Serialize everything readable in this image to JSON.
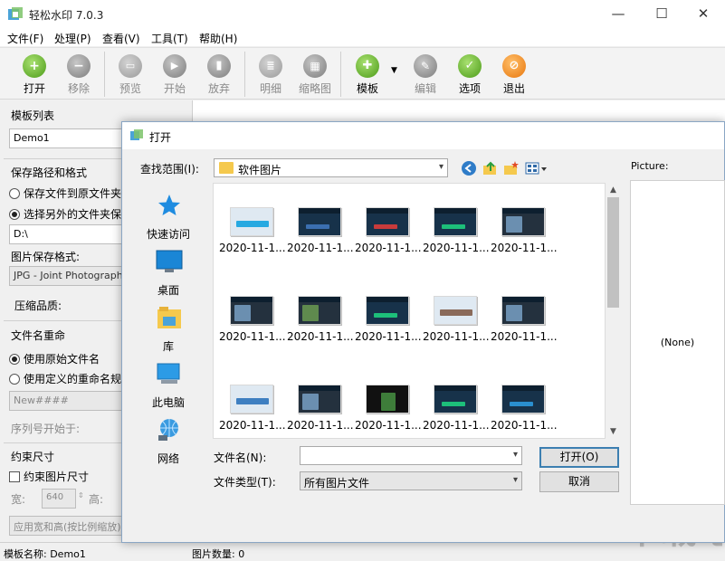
{
  "app": {
    "title": "轻松水印 7.0.3",
    "window_controls": {
      "minimize": "—",
      "maximize": "☐",
      "close": "✕"
    }
  },
  "menu": [
    "文件(F)",
    "处理(P)",
    "查看(V)",
    "工具(T)",
    "帮助(H)"
  ],
  "toolbar": [
    {
      "label": "打开",
      "icon": "plus-icon",
      "enabled": true
    },
    {
      "label": "移除",
      "icon": "minus-icon",
      "enabled": false
    },
    {
      "label": "预览",
      "icon": "monitor-icon",
      "enabled": false
    },
    {
      "label": "开始",
      "icon": "play-icon",
      "enabled": false
    },
    {
      "label": "放弃",
      "icon": "stop-icon",
      "enabled": false
    },
    {
      "label": "明细",
      "icon": "document-icon",
      "enabled": false
    },
    {
      "label": "缩略图",
      "icon": "grid-icon",
      "enabled": false
    },
    {
      "label": "模板",
      "icon": "puzzle-icon",
      "enabled": true
    },
    {
      "label": "编辑",
      "icon": "pencil-icon",
      "enabled": false
    },
    {
      "label": "选项",
      "icon": "wrench-icon",
      "enabled": true
    },
    {
      "label": "退出",
      "icon": "exit-icon",
      "enabled": true
    }
  ],
  "left_panel": {
    "template_list_title": "模板列表",
    "template_selected": "Demo1",
    "save_path_title": "保存路径和格式",
    "save_opt1": "保存文件到原文件夹",
    "save_opt2": "选择另外的文件夹保",
    "save_path_value": "D:\\",
    "format_label": "图片保存格式:",
    "format_value": "JPG - Joint Photographic",
    "quality_label": "压缩品质:",
    "rename_title": "文件名重命",
    "rename_opt1": "使用原始文件名",
    "rename_opt2": "使用定义的重命名规则",
    "rename_pattern": "New####",
    "seq_start_label": "序列号开始于:",
    "constraint_title": "约束尺寸",
    "constraint_check": "约束图片尺寸",
    "width_label": "宽:",
    "width_value": "640",
    "height_label": "高:",
    "scale_mode": "应用宽和高(按比例缩放)"
  },
  "status": {
    "template_name": "模板名称: Demo1",
    "image_count": "图片数量: 0"
  },
  "dialog": {
    "title": "打开",
    "look_in_label": "查找范围(I):",
    "look_in_value": "软件图片",
    "places": [
      {
        "label": "快速访问",
        "icon": "star-icon"
      },
      {
        "label": "桌面",
        "icon": "desktop-icon"
      },
      {
        "label": "库",
        "icon": "library-icon"
      },
      {
        "label": "此电脑",
        "icon": "computer-icon"
      },
      {
        "label": "网络",
        "icon": "network-icon"
      }
    ],
    "files": [
      "2020-11-1...",
      "2020-11-1...",
      "2020-11-1...",
      "2020-11-1...",
      "2020-11-1...",
      "2020-11-1...",
      "2020-11-1...",
      "2020-11-1...",
      "2020-11-1...",
      "2020-11-1...",
      "2020-11-1...",
      "2020-11-1...",
      "2020-11-1...",
      "2020-11-1...",
      "2020-11-1..."
    ],
    "filename_label": "文件名(N):",
    "filename_value": "",
    "filetype_label": "文件类型(T):",
    "filetype_value": "所有图片文件",
    "open_button": "打开(O)",
    "cancel_button": "取消",
    "preview_label": "Picture:",
    "preview_none": "(None)"
  }
}
